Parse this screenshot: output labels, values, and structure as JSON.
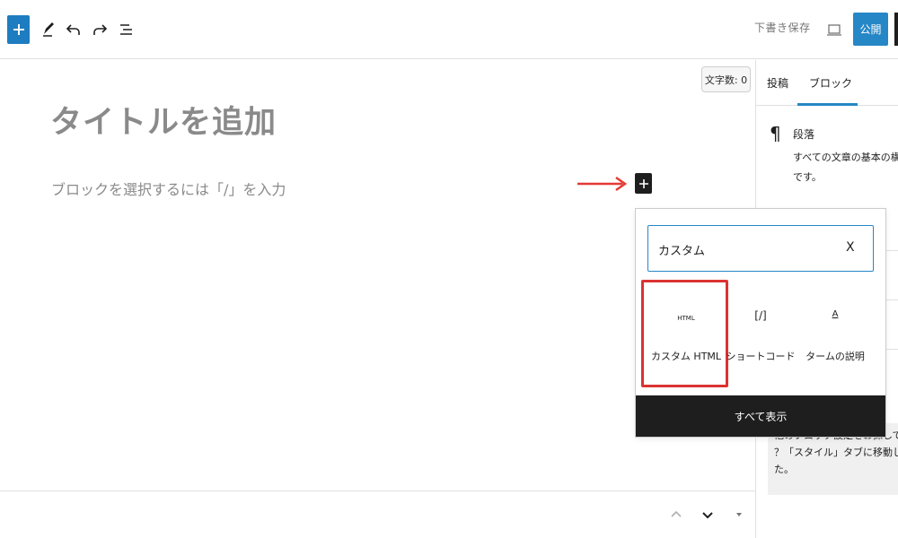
{
  "toolbar": {
    "save_draft_label": "下書き保存",
    "publish_label": "公開",
    "accent_color": "#2687c6"
  },
  "editor": {
    "word_count": "文字数: 0",
    "title_placeholder": "タイトルを追加",
    "paragraph_placeholder": "ブロックを選択するには「/」を入力"
  },
  "sidebar": {
    "tabs": [
      {
        "label": "投稿"
      },
      {
        "label": "ブロック"
      }
    ],
    "block_name": "段落",
    "block_description_line1": "すべての文章の基本の構成",
    "block_description_line2": "です。",
    "note_line1": "他のブロック設定をお探しです",
    "note_line2": "？「スタイル」タブに移動しま",
    "note_line3": "た。"
  },
  "inserter": {
    "search_value": "カスタム",
    "clear_label": "X",
    "results": [
      {
        "icon_text": "HTML",
        "label": "カスタム HTML"
      },
      {
        "icon_text": "[/]",
        "label": "ショートコード"
      },
      {
        "icon_text": "A",
        "label": "タームの説明"
      }
    ],
    "show_all_label": "すべて表示"
  }
}
